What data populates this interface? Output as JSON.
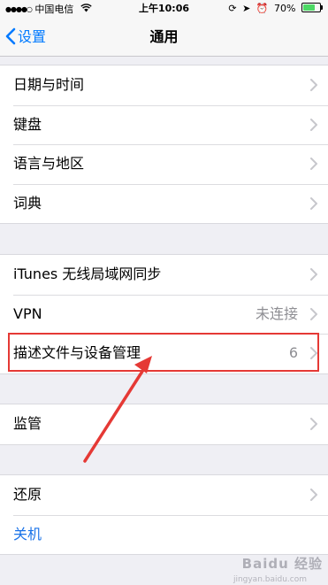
{
  "status_bar": {
    "carrier": "中国电信",
    "time": "上午10:06",
    "battery_percent": "70%",
    "battery_level": 0.7,
    "icons": [
      "signal-icon",
      "wifi-icon",
      "rotation-lock-icon",
      "location-icon",
      "alarm-icon",
      "battery-icon"
    ]
  },
  "nav": {
    "back_label": "设置",
    "title": "通用"
  },
  "group1": {
    "items": [
      {
        "label": "日期与时间"
      },
      {
        "label": "键盘"
      },
      {
        "label": "语言与地区"
      },
      {
        "label": "词典"
      }
    ]
  },
  "group2": {
    "items": [
      {
        "label": "iTunes 无线局域网同步",
        "value": ""
      },
      {
        "label": "VPN",
        "value": "未连接"
      },
      {
        "label": "描述文件与设备管理",
        "value": "6"
      }
    ]
  },
  "group3": {
    "items": [
      {
        "label": "监管"
      }
    ]
  },
  "group4": {
    "items": [
      {
        "label": "还原"
      },
      {
        "label": "关机"
      }
    ]
  },
  "annotation_color": "#e53935",
  "link_color": "#1a73e8",
  "accent_color": "#007aff",
  "watermark": {
    "text": "Baidu 经验",
    "subtext": "jingyan.baidu.com"
  }
}
